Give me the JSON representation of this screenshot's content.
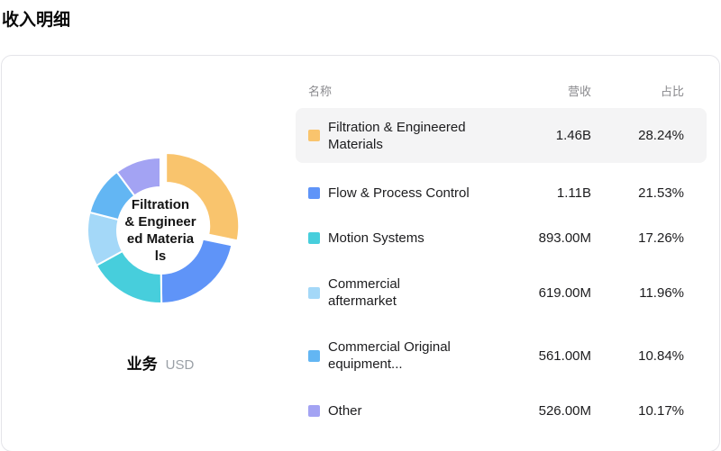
{
  "page": {
    "title": "收入明细"
  },
  "chart_data": {
    "type": "pie",
    "title": "收入明细",
    "dimension_label": "业务",
    "unit_label": "USD",
    "center_label": "Filtration\n& Engineer\ned Materia\nls",
    "legend_position": "right-table",
    "donut": {
      "inner_radius_ratio": 0.59,
      "start_angle_deg": 0,
      "direction": "clockwise"
    },
    "segments": [
      {
        "name": "Filtration & Engineered Materials",
        "revenue": "1.46B",
        "share_pct": 28.24,
        "color": "#F9C46D",
        "exploded": true
      },
      {
        "name": "Flow & Process Control",
        "revenue": "1.11B",
        "share_pct": 21.53,
        "color": "#5F94F8",
        "exploded": false
      },
      {
        "name": "Motion Systems",
        "revenue": "893.00M",
        "share_pct": 17.26,
        "color": "#47CEDC",
        "exploded": false
      },
      {
        "name": "Commercial aftermarket",
        "revenue": "619.00M",
        "share_pct": 11.96,
        "color": "#A4D8F8",
        "exploded": false
      },
      {
        "name": "Commercial Original equipment...",
        "revenue": "561.00M",
        "share_pct": 10.84,
        "color": "#63B6F3",
        "exploded": false
      },
      {
        "name": "Other",
        "revenue": "526.00M",
        "share_pct": 10.17,
        "color": "#A3A3F3",
        "exploded": false
      }
    ]
  },
  "table": {
    "headers": {
      "name": "名称",
      "revenue": "营收",
      "share": "占比"
    },
    "rows": [
      {
        "name": "Filtration & Engineered\nMaterials",
        "revenue": "1.46B",
        "share": "28.24%",
        "color": "#F9C46D",
        "highlighted": true
      },
      {
        "name": "Flow & Process Control",
        "revenue": "1.11B",
        "share": "21.53%",
        "color": "#5F94F8",
        "highlighted": false
      },
      {
        "name": "Motion Systems",
        "revenue": "893.00M",
        "share": "17.26%",
        "color": "#47CEDC",
        "highlighted": false
      },
      {
        "name": "Commercial\naftermarket",
        "revenue": "619.00M",
        "share": "11.96%",
        "color": "#A4D8F8",
        "highlighted": false
      },
      {
        "name": "Commercial Original\nequipment...",
        "revenue": "561.00M",
        "share": "10.84%",
        "color": "#63B6F3",
        "highlighted": false
      },
      {
        "name": "Other",
        "revenue": "526.00M",
        "share": "10.17%",
        "color": "#A3A3F3",
        "highlighted": false
      }
    ]
  }
}
